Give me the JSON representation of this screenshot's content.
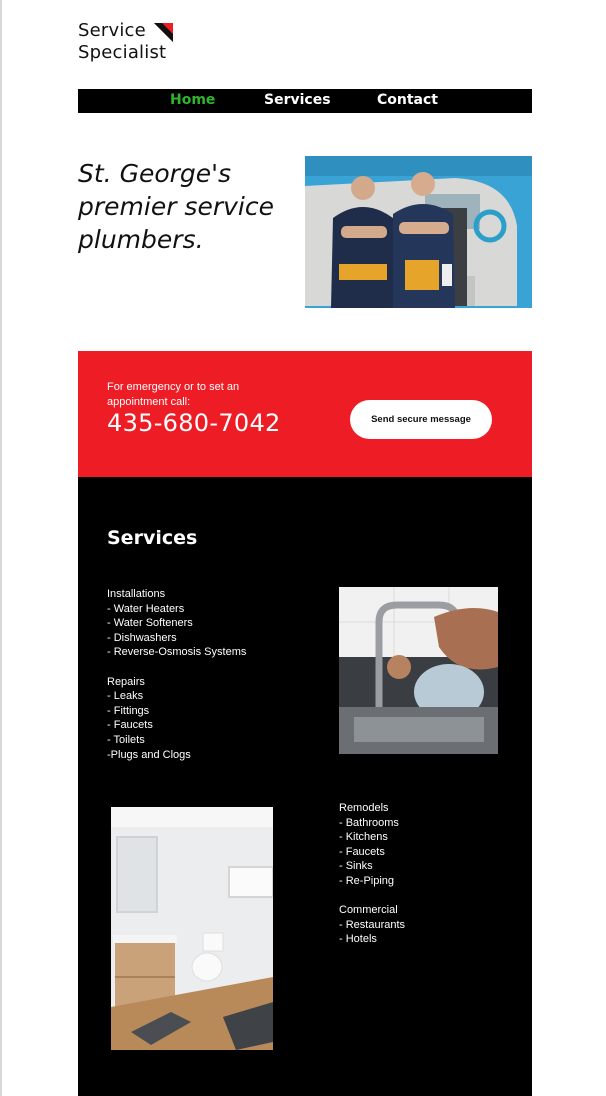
{
  "brand": {
    "name_line1": "Service",
    "name_line2": "Specialist",
    "accent_color": "#ee1c25",
    "logo_icon": "diagonal-flag-icon"
  },
  "nav": {
    "items": [
      {
        "label": "Home",
        "active": true
      },
      {
        "label": "Services",
        "active": false
      },
      {
        "label": "Contact",
        "active": false
      }
    ],
    "active_color": "#2db52b"
  },
  "hero": {
    "title": "St. George's premier service plumbers.",
    "photo": "two-plumbers-by-van-photo"
  },
  "cta": {
    "label": "For emergency or to set an appointment call:",
    "phone": "435-680-7042",
    "button_label": "Send secure message"
  },
  "services": {
    "title": "Services",
    "installations": {
      "heading": "Installations",
      "items": [
        "- Water Heaters",
        "- Water Softeners",
        "- Dishwashers",
        "- Reverse-Osmosis Systems"
      ]
    },
    "repairs": {
      "heading": "Repairs",
      "items": [
        "- Leaks",
        "- Fittings",
        "- Faucets",
        "- Toilets",
        "-Plugs and Clogs"
      ]
    },
    "remodels": {
      "heading": "Remodels",
      "items": [
        "- Bathrooms",
        "- Kitchens",
        "- Faucets",
        "- Sinks",
        "- Re-Piping"
      ]
    },
    "commercial": {
      "heading": "Commercial",
      "items": [
        "- Restaurants",
        "- Hotels"
      ]
    },
    "photo_faucet": "kitchen-faucet-photo",
    "photo_bath": "bathroom-vanity-photo"
  }
}
